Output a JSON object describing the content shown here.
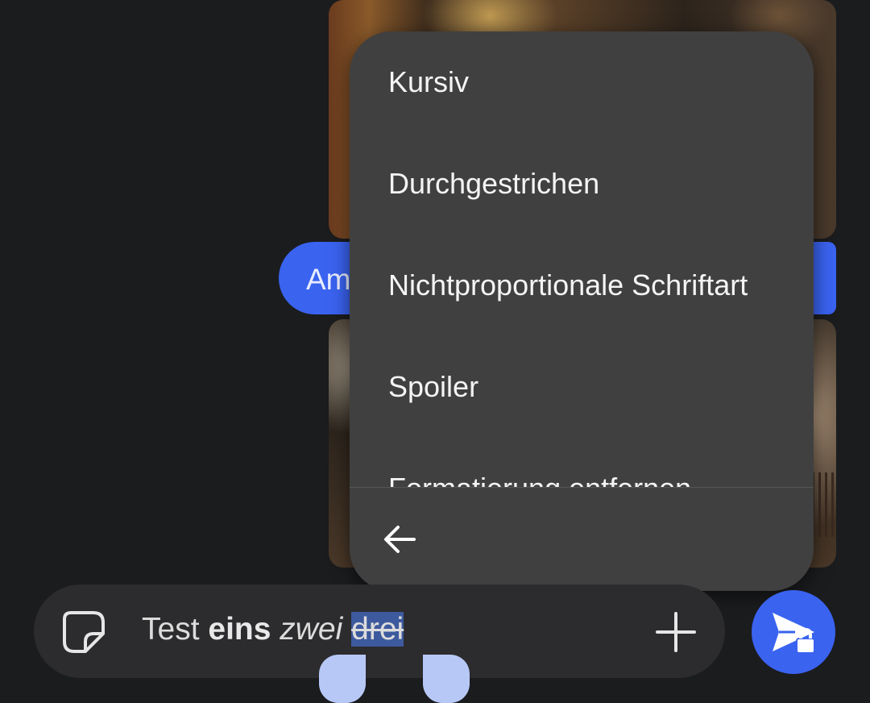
{
  "chat": {
    "bubble_text": "Am"
  },
  "format_menu": {
    "items": [
      {
        "label": "Kursiv"
      },
      {
        "label": "Durchgestrichen"
      },
      {
        "label": "Nichtproportionale Schriftart"
      },
      {
        "label": "Spoiler"
      },
      {
        "label": "Formatierung entfernen"
      }
    ],
    "back_icon": "arrow-back-icon"
  },
  "composer": {
    "text_plain": "Test",
    "text_bold": "eins",
    "text_italic": "zwei",
    "text_selected_strike": "drei",
    "sticker_icon": "sticker-icon",
    "attach_icon": "plus-icon",
    "send_icon": "send-lock-icon"
  },
  "colors": {
    "accent": "#3a63f0",
    "menu_bg": "#404040",
    "background": "#1b1c1e",
    "selection_handle": "#b7c8f7"
  }
}
